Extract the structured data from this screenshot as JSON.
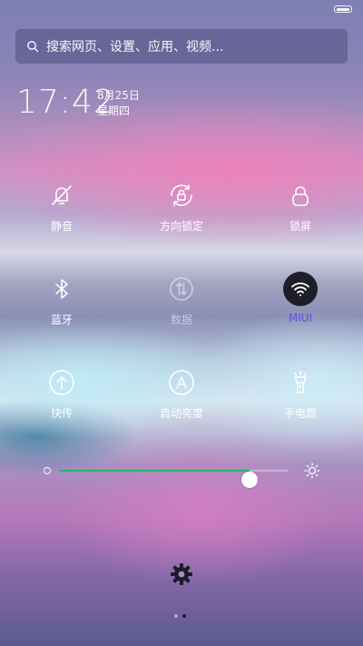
{
  "status": {
    "battery_icon": "battery-icon"
  },
  "search": {
    "placeholder": "搜索网页、设置、应用、视频...",
    "icon": "search-icon"
  },
  "clock": {
    "time": "17:42",
    "date": "8月25日",
    "weekday": "星期四"
  },
  "toggles": [
    {
      "label": "静音",
      "icon": "bell-off-icon",
      "state": "off"
    },
    {
      "label": "方向锁定",
      "icon": "rotation-lock-icon",
      "state": "off"
    },
    {
      "label": "锁屏",
      "icon": "lock-icon",
      "state": "off"
    },
    {
      "label": "蓝牙",
      "icon": "bluetooth-icon",
      "state": "off"
    },
    {
      "label": "数据",
      "icon": "mobile-data-icon",
      "state": "disabled"
    },
    {
      "label": "MIUI",
      "icon": "wifi-icon",
      "state": "on"
    },
    {
      "label": "快传",
      "icon": "quick-transfer-icon",
      "state": "off"
    },
    {
      "label": "自动亮度",
      "icon": "auto-brightness-icon",
      "state": "off"
    },
    {
      "label": "手电筒",
      "icon": "flashlight-icon",
      "state": "off"
    }
  ],
  "brightness": {
    "level": 0.83,
    "track_color": "#27b46a"
  },
  "settings": {
    "icon": "gear-icon"
  },
  "pager": {
    "pages": 2,
    "current": 2
  },
  "colors": {
    "active_label": "#5c4fe0",
    "active_bg": "#1e1e2a"
  }
}
